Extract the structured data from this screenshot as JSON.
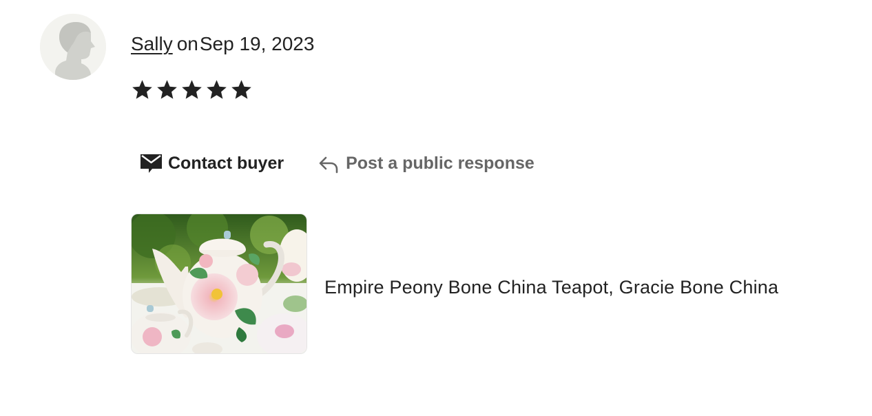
{
  "review": {
    "reviewer_name": "Sally",
    "on_word": "on",
    "date": "Sep 19, 2023",
    "rating": 5,
    "rating_max": 5
  },
  "actions": {
    "contact_label": "Contact buyer",
    "respond_label": "Post a public response"
  },
  "listing": {
    "title": "Empire Peony Bone China Teapot, Gracie Bone China"
  },
  "icons": {
    "avatar": "default-avatar-icon",
    "star": "star-icon",
    "contact": "envelope-icon",
    "respond": "reply-arrow-icon"
  },
  "colors": {
    "text": "#222222",
    "muted": "#666666",
    "avatar_bg": "#f3f3ef",
    "avatar_silhouette": "#d0d1cc"
  }
}
